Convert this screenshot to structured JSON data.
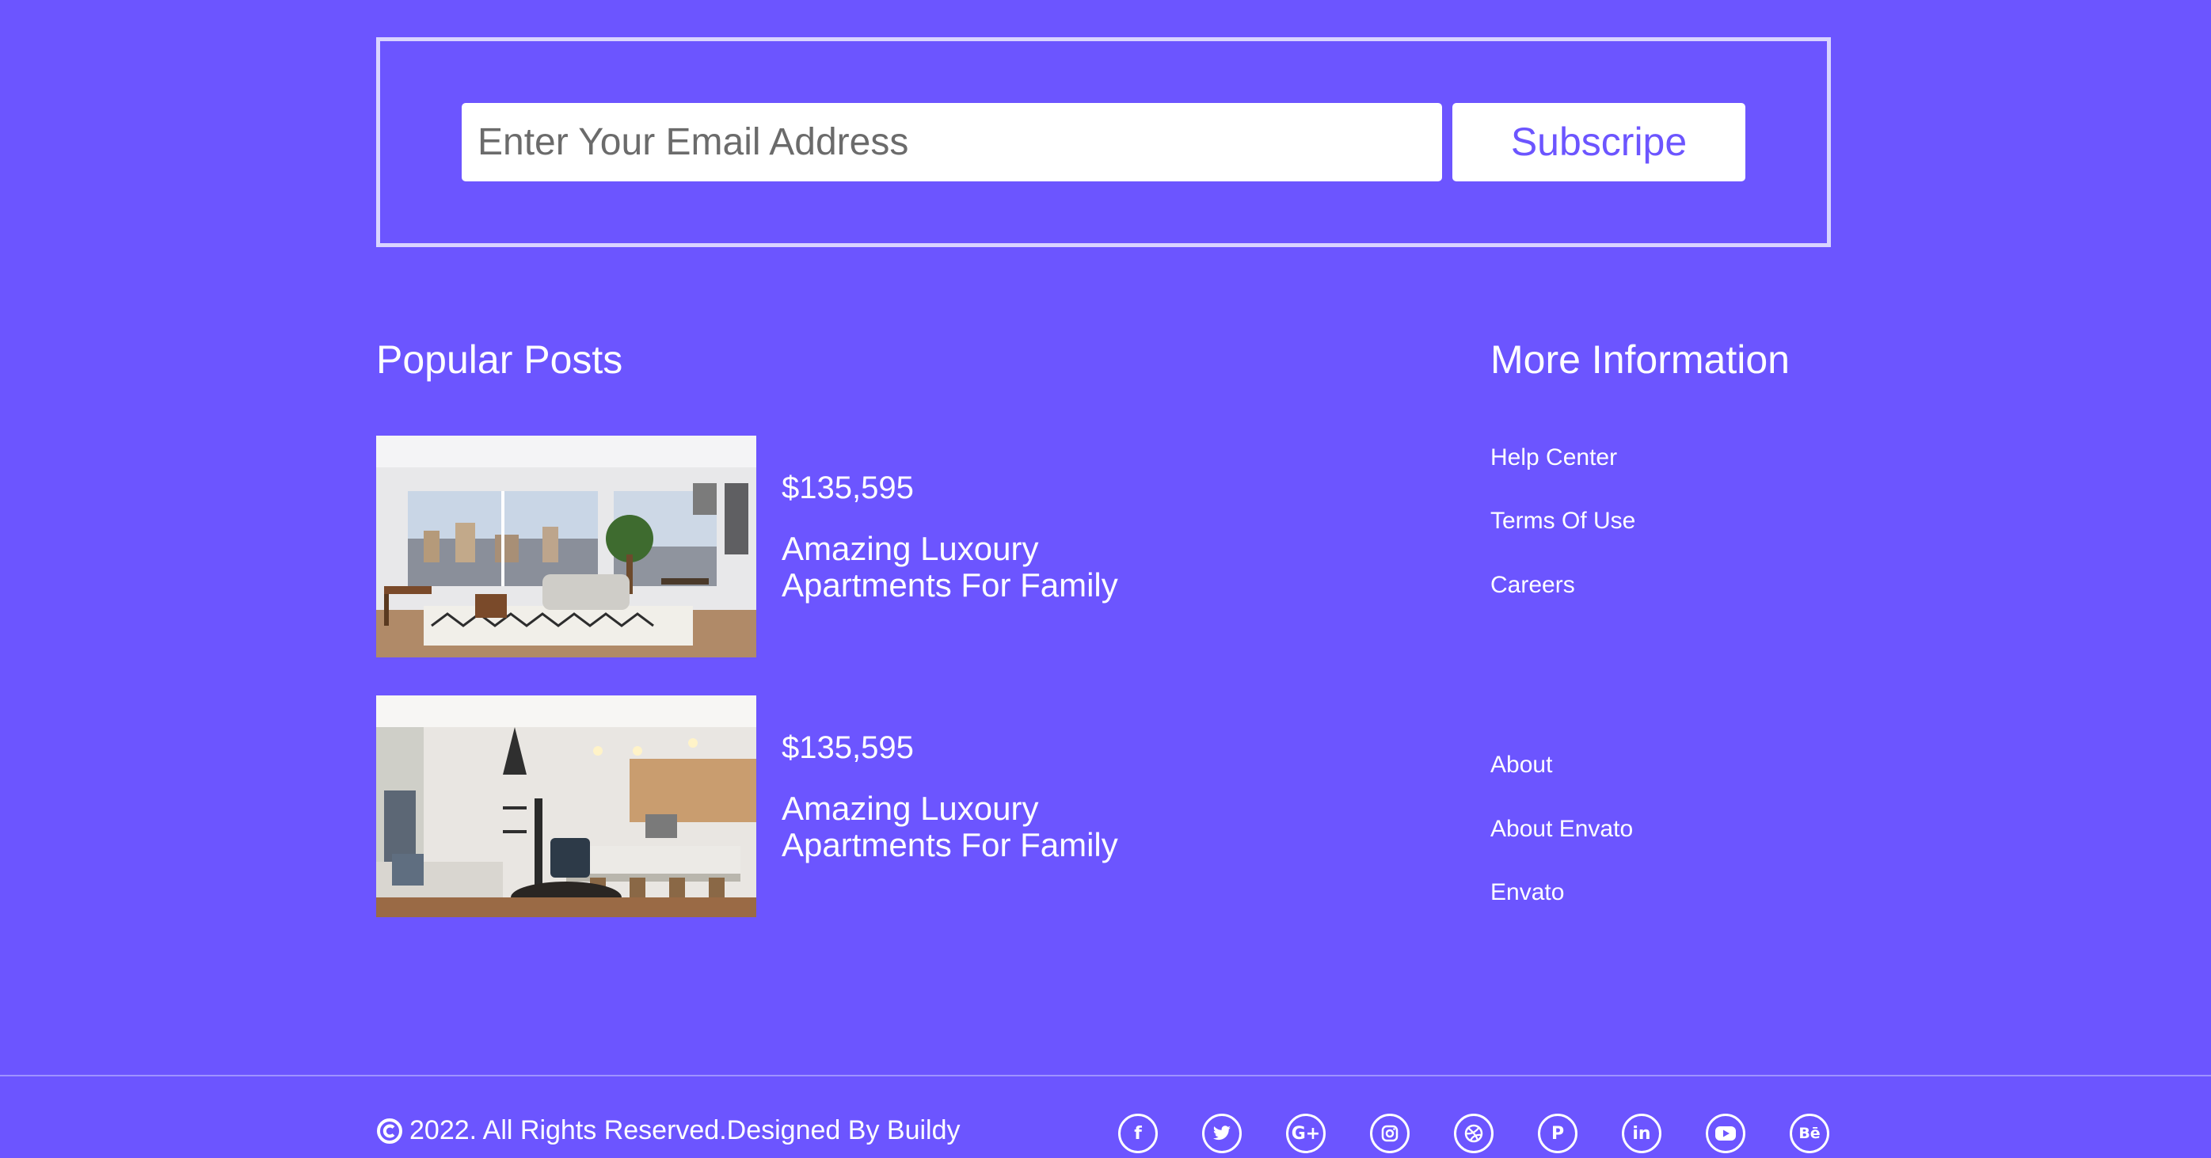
{
  "subscribe": {
    "email_placeholder": "Enter Your Email Address",
    "button_label": "Subscripe"
  },
  "popular_posts": {
    "heading": "Popular Posts",
    "items": [
      {
        "price": "$135,595",
        "title": "Amazing Luxoury Apartments For Family",
        "image": "living-room-photo"
      },
      {
        "price": "$135,595",
        "title": "Amazing Luxoury Apartments For Family",
        "image": "kitchen-living-photo"
      }
    ]
  },
  "more_information": {
    "heading": "More Information",
    "links": [
      "Help Center",
      "Terms Of Use",
      "Careers",
      "About",
      "About Envato",
      "Envato"
    ]
  },
  "footer": {
    "copyright": "2022. All Rights Reserved.Designed By Buildy",
    "social_icons": [
      "facebook-icon",
      "twitter-icon",
      "google-plus-icon",
      "instagram-icon",
      "dribbble-icon",
      "pinterest-icon",
      "linkedin-icon",
      "youtube-icon",
      "behance-icon"
    ]
  },
  "colors": {
    "background": "#6c55ff",
    "accent": "#6c55ff",
    "text": "#ffffff"
  }
}
